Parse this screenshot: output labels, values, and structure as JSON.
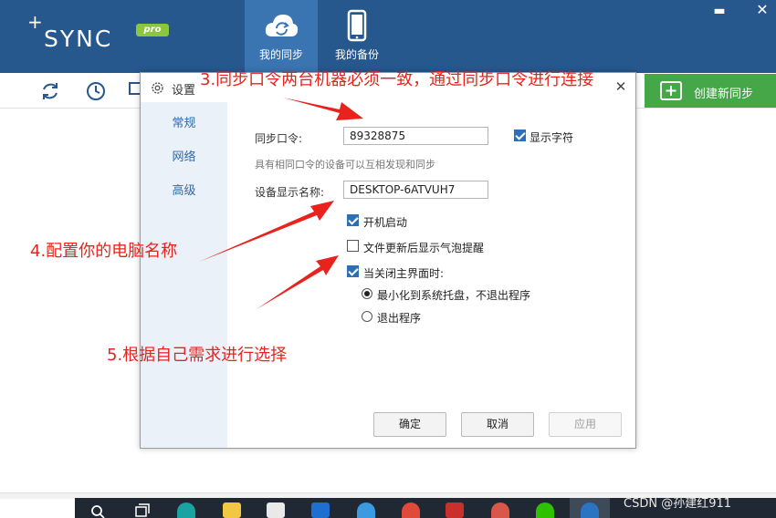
{
  "app": {
    "logo_text": "SYNC",
    "logo_plus": "+",
    "pro_badge": "pro",
    "tabs": [
      {
        "label": "我的同步",
        "icon": "cloud-sync-icon",
        "active": true
      },
      {
        "label": "我的备份",
        "icon": "phone-icon",
        "active": false
      }
    ],
    "window_controls": {
      "minimize": "▬",
      "close": "✕"
    },
    "header_color": "#26588e",
    "active_tab_color": "#3a74b1"
  },
  "toolbar": {
    "icons": [
      "refresh-icon",
      "clock-icon",
      "monitor-icon"
    ],
    "create_button_label": "创建新同步",
    "create_button_color": "#45a748"
  },
  "dialog": {
    "title": "设置",
    "close_glyph": "✕",
    "sidebar": [
      "常规",
      "网络",
      "高级"
    ],
    "sync_password": {
      "label": "同步口令:",
      "value": "89328875"
    },
    "show_chars": {
      "label": "显示字符",
      "checked": true
    },
    "hint": "具有相同口令的设备可以互相发现和同步",
    "device_name": {
      "label": "设备显示名称:",
      "value": "DESKTOP-6ATVUH7"
    },
    "options": [
      {
        "label": "开机启动",
        "checked": true
      },
      {
        "label": "文件更新后显示气泡提醒",
        "checked": false
      },
      {
        "label": "当关闭主界面时:",
        "checked": true
      }
    ],
    "close_actions": [
      {
        "label": "最小化到系统托盘，不退出程序",
        "selected": true
      },
      {
        "label": "退出程序",
        "selected": false
      }
    ],
    "buttons": {
      "ok": "确定",
      "cancel": "取消",
      "apply": "应用"
    }
  },
  "annotations": {
    "step3": "3.同步口令两台机器必须一致，通过同步口令进行连接",
    "step4": "4.配置你的电脑名称",
    "step5": "5.根据自己需求进行选择",
    "color": "#e8231d"
  },
  "taskbar": {
    "icons": [
      "search-icon",
      "task-view-icon",
      "edge-icon",
      "file-explorer-icon",
      "store-icon",
      "mail-icon",
      "ie-icon",
      "chrome-icon",
      "wps-icon",
      "app-icon",
      "wechat-icon",
      "sync-app-icon"
    ]
  },
  "watermark": "CSDN @孙建红911"
}
